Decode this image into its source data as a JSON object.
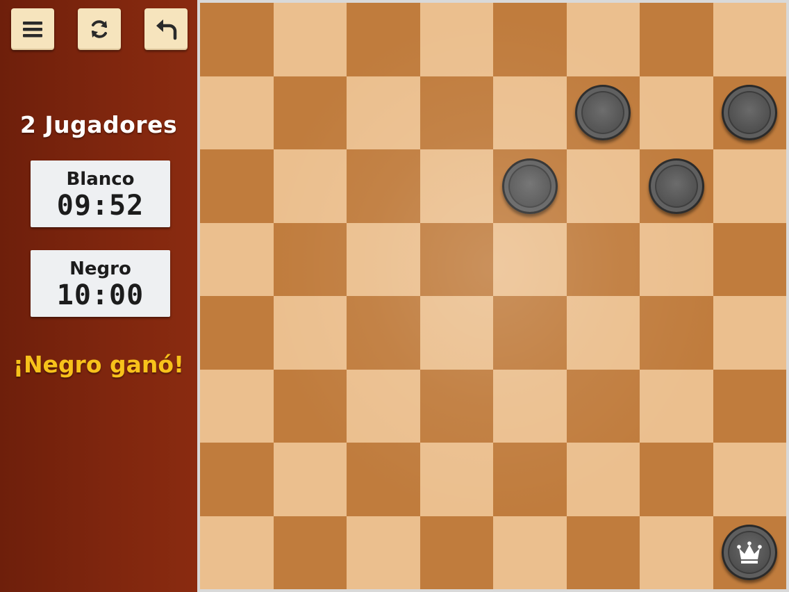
{
  "toolbar": {
    "menu_icon": "hamburger-menu-icon",
    "restart_icon": "refresh-icon",
    "undo_icon": "undo-arrow-icon"
  },
  "sidebar": {
    "mode_title": "2 Jugadores",
    "players": [
      {
        "name": "Blanco",
        "time": "09:52"
      },
      {
        "name": "Negro",
        "time": "10:00"
      }
    ],
    "result": "¡Negro ganó!"
  },
  "colors": {
    "sidebar": "#7f260e",
    "button_bg": "#f6e4bd",
    "result_text": "#f7c21b",
    "light_square": "#ebbf8e",
    "dark_square": "#c07c3d",
    "black_piece": "#4e4e4e"
  },
  "board": {
    "size": 8,
    "pieces": [
      {
        "row": 1,
        "col": 5,
        "color": "black",
        "king": false
      },
      {
        "row": 1,
        "col": 7,
        "color": "black",
        "king": false
      },
      {
        "row": 2,
        "col": 4,
        "color": "black",
        "king": false
      },
      {
        "row": 2,
        "col": 6,
        "color": "black",
        "king": false
      },
      {
        "row": 7,
        "col": 7,
        "color": "black",
        "king": true
      }
    ]
  }
}
